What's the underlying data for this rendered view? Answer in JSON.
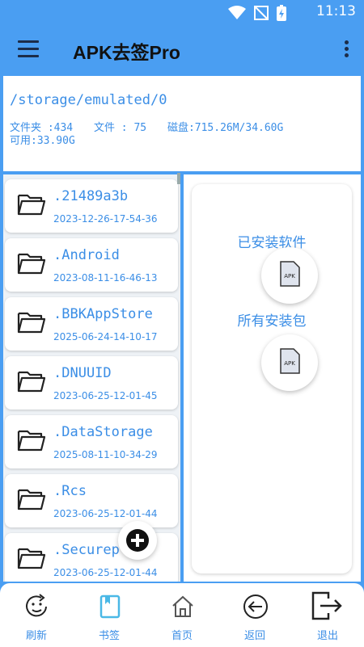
{
  "status_bar": {
    "time": "11:13"
  },
  "app_bar": {
    "title": "APK去签Pro"
  },
  "path_panel": {
    "path": "/storage/emulated/0",
    "folders": "文件夹 :434",
    "files": "文件 : 75",
    "disk": "磁盘:715.26M/34.60G",
    "available": "可用:33.90G"
  },
  "folders": [
    {
      "name": ".21489a3b",
      "date": "2023-12-26-17-54-36"
    },
    {
      "name": ".Android",
      "date": "2023-08-11-16-46-13"
    },
    {
      "name": ".BBKAppStore",
      "date": "2025-06-24-14-10-17"
    },
    {
      "name": ".DNUUID",
      "date": "2023-06-25-12-01-45"
    },
    {
      "name": ".DataStorage",
      "date": "2025-08-11-10-34-29"
    },
    {
      "name": ".Rcs",
      "date": "2023-06-25-12-01-44"
    },
    {
      "name": ".Securep",
      "date": "2023-06-25-12-01-44"
    }
  ],
  "right_panel": {
    "installed_label": "已安装软件",
    "all_packages_label": "所有安装包",
    "apk_icon_text": "APK"
  },
  "bottom_nav": [
    {
      "label": "刷新",
      "icon": "refresh-face-icon"
    },
    {
      "label": "书签",
      "icon": "bookmark-icon"
    },
    {
      "label": "首页",
      "icon": "home-icon"
    },
    {
      "label": "返回",
      "icon": "back-icon"
    },
    {
      "label": "退出",
      "icon": "exit-icon"
    }
  ]
}
